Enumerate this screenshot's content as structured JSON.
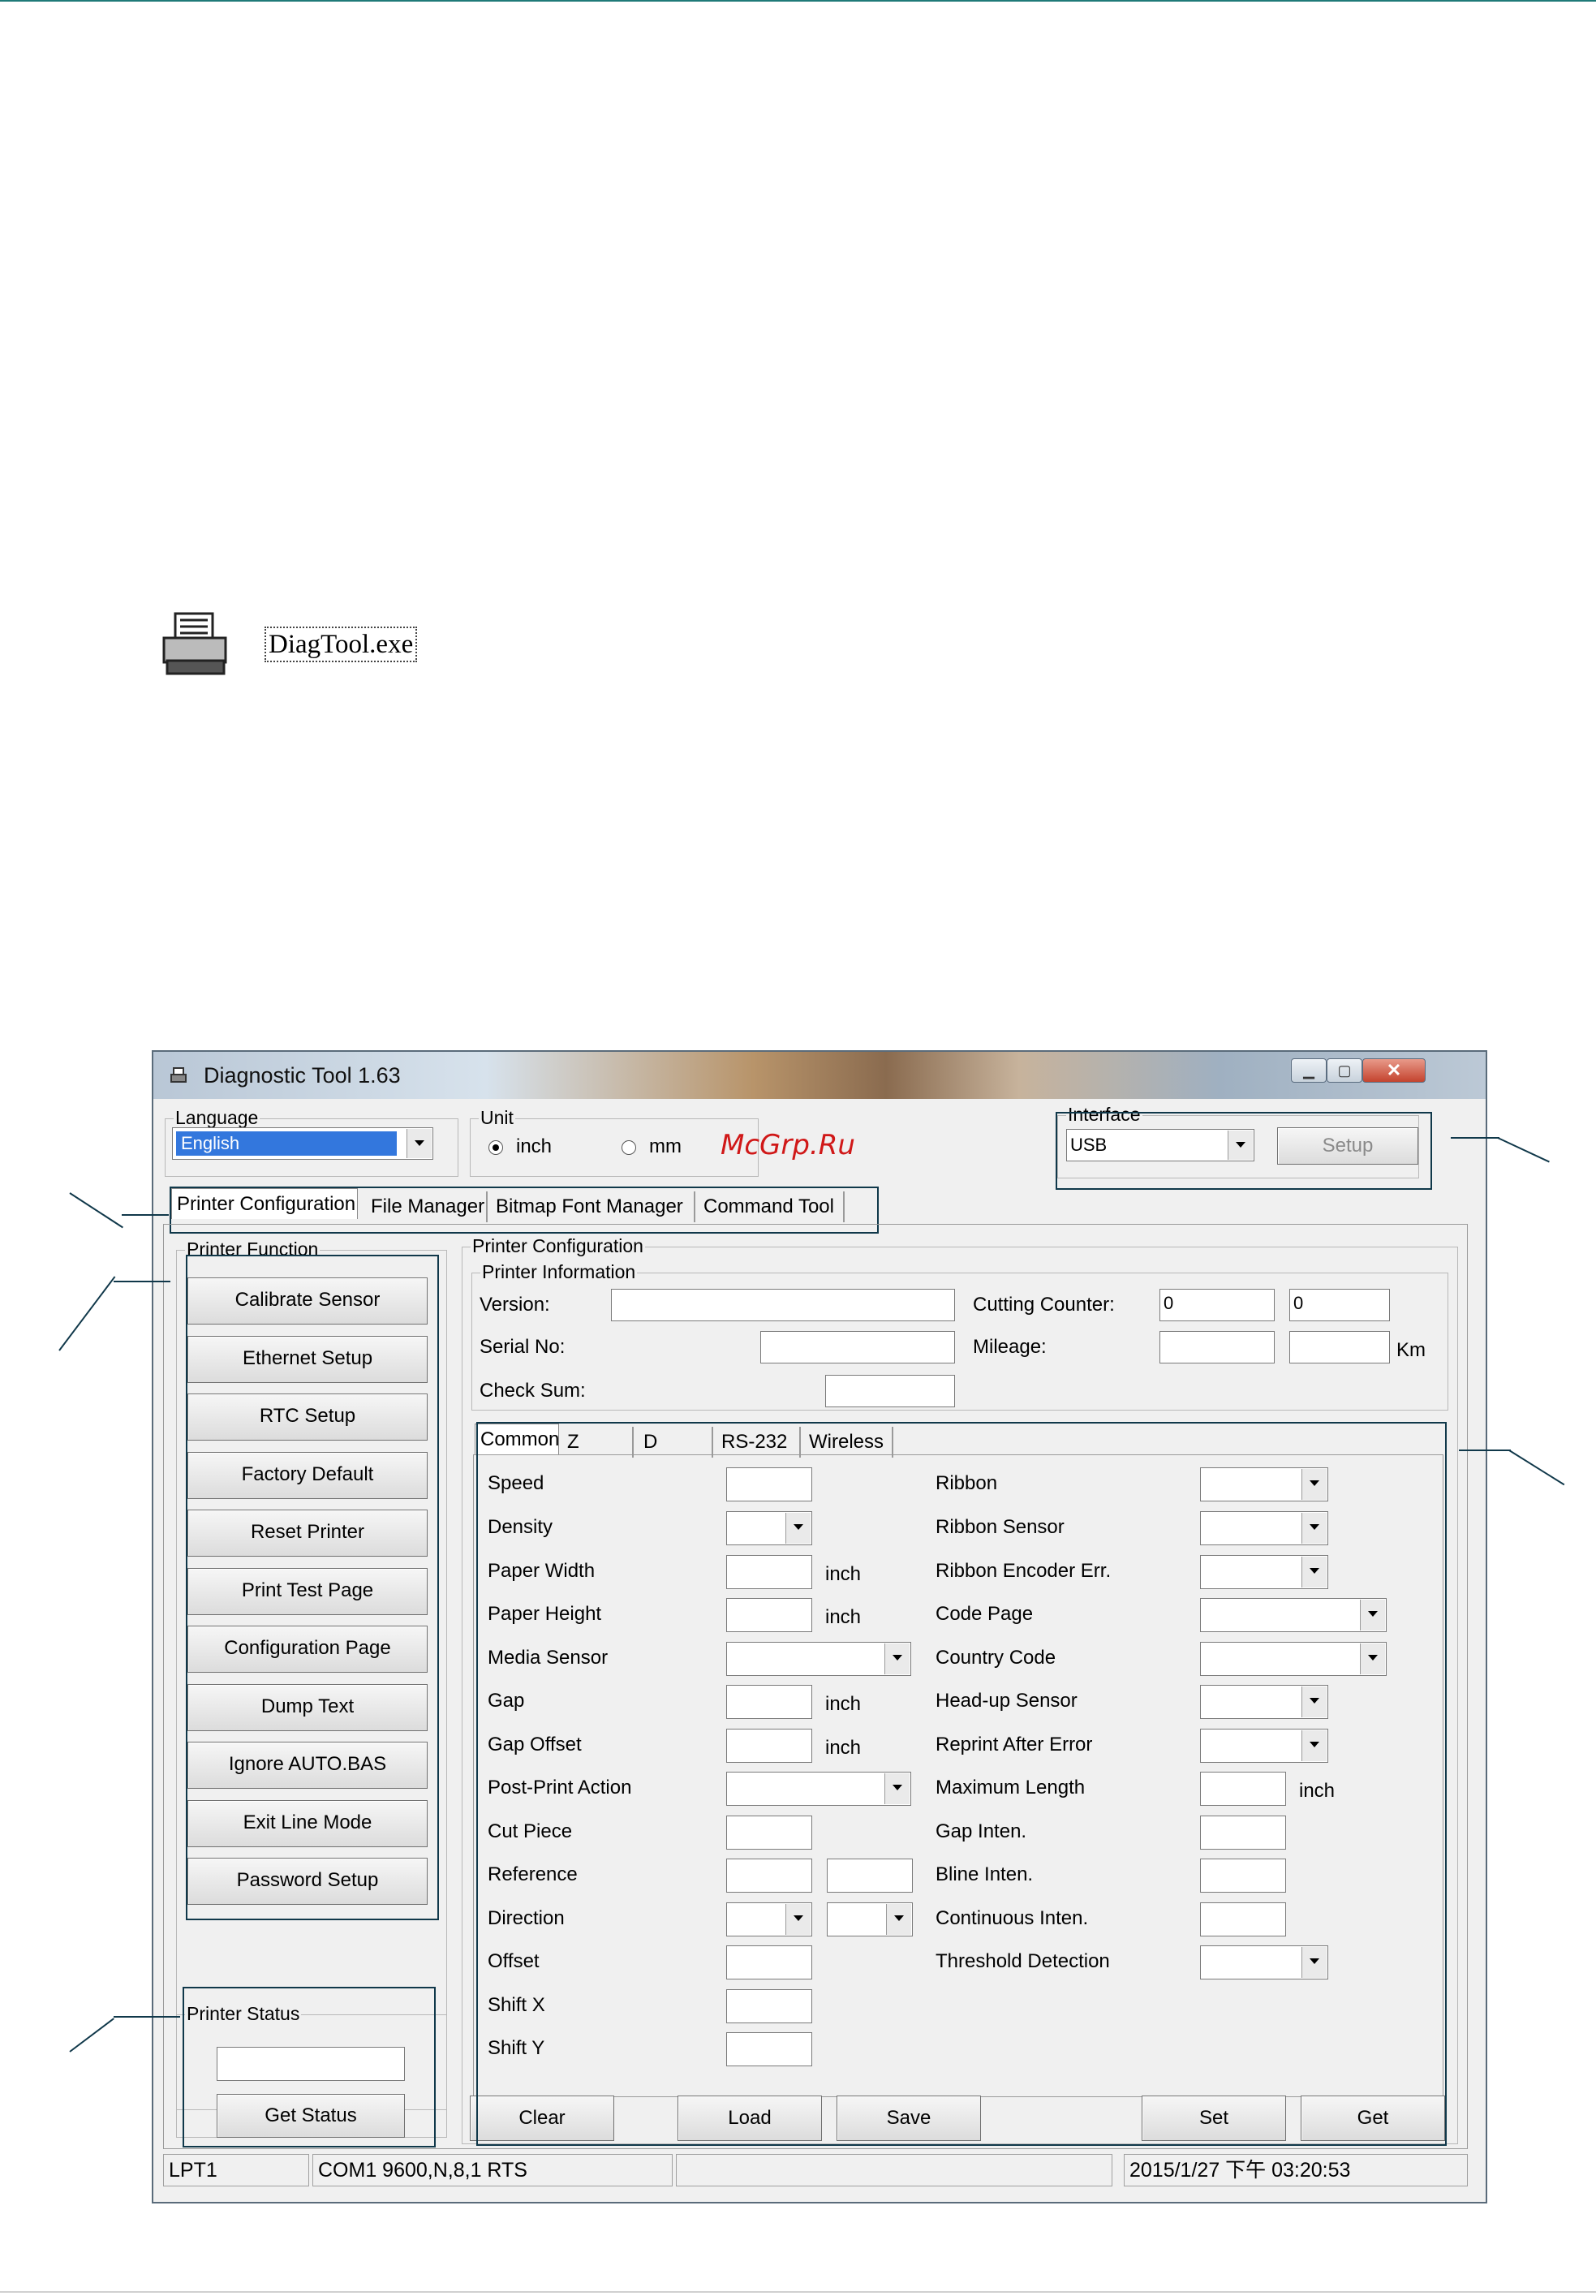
{
  "desktop_icon": {
    "label": "DiagTool.exe",
    "icon": "printer-icon"
  },
  "window": {
    "title": "Diagnostic Tool 1.63",
    "controls": {
      "minimize": "minimize-icon",
      "maximize": "maximize-icon",
      "close": "close-icon"
    }
  },
  "watermark": "McGrp.Ru",
  "language": {
    "label": "Language",
    "value": "English"
  },
  "unit": {
    "label": "Unit",
    "options": [
      "inch",
      "mm"
    ],
    "selected": "inch"
  },
  "interface": {
    "label": "Interface",
    "value": "USB",
    "setup_button": "Setup"
  },
  "main_tabs": [
    "Printer Configuration",
    "File Manager",
    "Bitmap Font Manager",
    "Command Tool"
  ],
  "printer_function": {
    "title": "Printer Function",
    "buttons": [
      "Calibrate Sensor",
      "Ethernet Setup",
      "RTC Setup",
      "Factory Default",
      "Reset Printer",
      "Print Test Page",
      "Configuration Page",
      "Dump Text",
      "Ignore AUTO.BAS",
      "Exit Line Mode",
      "Password Setup"
    ]
  },
  "printer_status": {
    "title": "Printer Status",
    "value": "",
    "button": "Get Status"
  },
  "printer_configuration": {
    "title": "Printer Configuration",
    "info": {
      "title": "Printer Information",
      "version_label": "Version:",
      "serial_label": "Serial No:",
      "checksum_label": "Check Sum:",
      "cutting_counter_label": "Cutting Counter:",
      "cutting_counter_values": [
        "0",
        "0"
      ],
      "mileage_label": "Mileage:",
      "mileage_unit": "Km"
    },
    "sub_tabs": [
      "Common",
      "Z",
      "D",
      "RS-232",
      "Wireless"
    ],
    "left_labels": [
      "Speed",
      "Density",
      "Paper Width",
      "Paper Height",
      "Media Sensor",
      "Gap",
      "Gap Offset",
      "Post-Print Action",
      "Cut Piece",
      "Reference",
      "Direction",
      "Offset",
      "Shift X",
      "Shift Y"
    ],
    "right_labels": [
      "Ribbon",
      "Ribbon Sensor",
      "Ribbon Encoder Err.",
      "Code Page",
      "Country Code",
      "Head-up Sensor",
      "Reprint After Error",
      "Maximum Length",
      "Gap Inten.",
      "Bline Inten.",
      "Continuous Inten.",
      "Threshold Detection"
    ],
    "unit_inch": "inch",
    "buttons": [
      "Clear",
      "Load",
      "Save",
      "Set",
      "Get"
    ]
  },
  "status_bar": {
    "lpt": "LPT1",
    "com": "COM1 9600,N,8,1 RTS",
    "middle": "",
    "datetime": "2015/1/27 下午 03:20:53"
  }
}
